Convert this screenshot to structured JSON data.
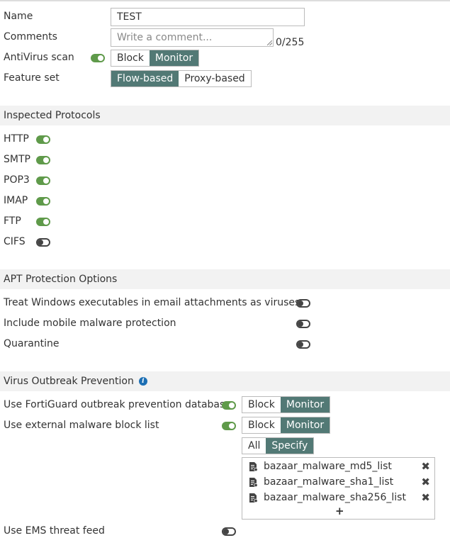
{
  "form": {
    "name_label": "Name",
    "name_value": "TEST",
    "comments_label": "Comments",
    "comments_placeholder": "Write a comment...",
    "comments_counter": "0/255",
    "antivirus_label": "AntiVirus scan",
    "antivirus_enabled": true,
    "antivirus_options": [
      "Block",
      "Monitor"
    ],
    "antivirus_selected": "Monitor",
    "feature_set_label": "Feature set",
    "feature_set_options": [
      "Flow-based",
      "Proxy-based"
    ],
    "feature_set_selected": "Flow-based"
  },
  "inspected_protocols": {
    "title": "Inspected Protocols",
    "items": [
      {
        "label": "HTTP",
        "enabled": true
      },
      {
        "label": "SMTP",
        "enabled": true
      },
      {
        "label": "POP3",
        "enabled": true
      },
      {
        "label": "IMAP",
        "enabled": true
      },
      {
        "label": "FTP",
        "enabled": true
      },
      {
        "label": "CIFS",
        "enabled": false
      }
    ]
  },
  "apt_protection": {
    "title": "APT Protection Options",
    "items": [
      {
        "label": "Treat Windows executables in email attachments as viruses",
        "enabled": false
      },
      {
        "label": "Include mobile malware protection",
        "enabled": false
      },
      {
        "label": "Quarantine",
        "enabled": false
      }
    ]
  },
  "virus_outbreak": {
    "title": "Virus Outbreak Prevention",
    "fortiguard_label": "Use FortiGuard outbreak prevention database",
    "fortiguard_enabled": true,
    "fortiguard_options": [
      "Block",
      "Monitor"
    ],
    "fortiguard_selected": "Monitor",
    "external_label": "Use external malware block list",
    "external_enabled": true,
    "external_options": [
      "Block",
      "Monitor"
    ],
    "external_selected": "Monitor",
    "scope_options": [
      "All",
      "Specify"
    ],
    "scope_selected": "Specify",
    "lists": [
      "bazaar_malware_md5_list",
      "bazaar_malware_sha1_list",
      "bazaar_malware_sha256_list"
    ],
    "remove_glyph": "✖",
    "add_glyph": "+",
    "ems_label": "Use EMS threat feed",
    "ems_enabled": false
  },
  "icons": {
    "info": "info-icon",
    "list_entry": "document-icon",
    "remove": "close-icon",
    "add": "plus-icon"
  },
  "colors": {
    "accent": "#527975",
    "toggle_on": "#5f9a4a",
    "info": "#1c6fb4",
    "section_bg": "#f2f2f2"
  }
}
